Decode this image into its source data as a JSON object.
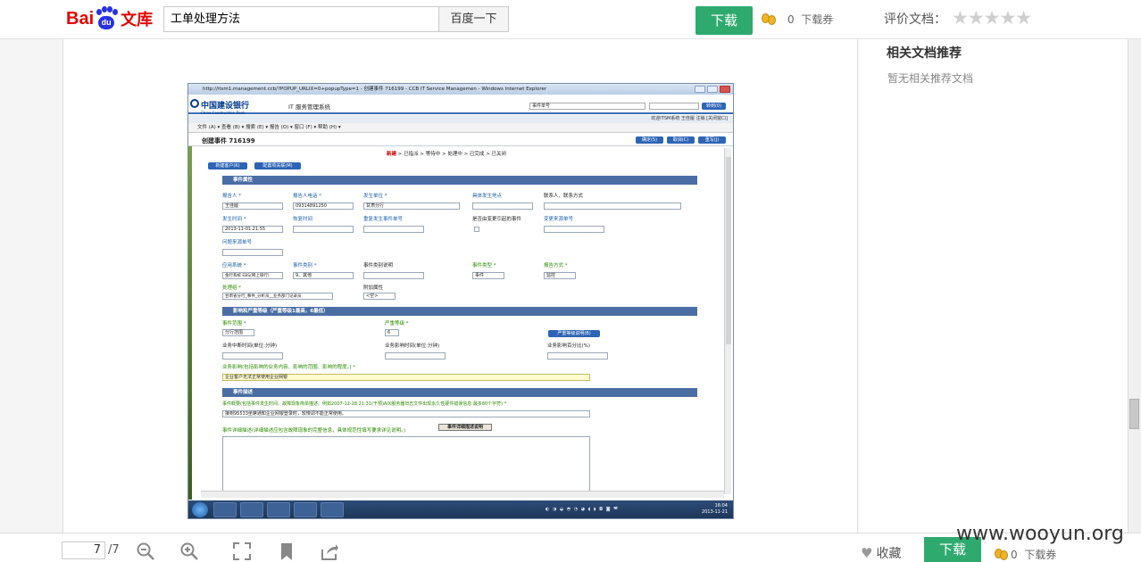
{
  "header": {
    "logo_text_1": "Bai",
    "logo_text_2": "du",
    "logo_text_3": "文库",
    "search_value": "工单处理方法",
    "search_button": "百度一下",
    "download_button": "下载",
    "voucher_count": "0",
    "voucher_label": "下载券",
    "rating_label": "评价文档：",
    "stars": "★★★★★"
  },
  "sidebar": {
    "title": "相关文档推荐",
    "empty_text": "暂无相关推荐文档"
  },
  "bottom": {
    "page_current": "7",
    "page_total": "/7",
    "favorite": "收藏",
    "download_button": "下载",
    "voucher_count": "0",
    "voucher_label": "下载券"
  },
  "watermark": "www.wooyun.org",
  "screenshot": {
    "ie_title": "http://itsm1.management.ccb/?POPUP_URLIX=0+popupType=1 - 创建事件 716199 - CCB IT Service Managemen - Windows Internet Explorer",
    "bank_name": "中国建设银行",
    "bank_name_en": "China Construction Bank",
    "system_name": "IT 服务管理系统",
    "search_select": "事件单号",
    "go_button": "转到(0)",
    "user_bar": "欢迎ITSM系统   王佳履  注销  [关闭窗口]",
    "menu": "文件 (A) ▾   查看 (B) ▾   搜索 (E) ▾   报告 (O) ▾   窗口 (F) ▾   帮助 (H) ▾",
    "event_title": "创建事件  716199",
    "ev_buttons": [
      "确定(S)",
      "取消(C)",
      "重写(J)"
    ],
    "steps_active": "新建",
    "steps_rest": " > 已指派 > 等待中 > 处理中 > 已完成 > 已关闭",
    "btn_new_customer": "新建客户(K)",
    "btn_config": "配置项关联(M)",
    "section_1": "事件属性",
    "reporter_label": "报告人 *",
    "reporter_value": "王佳履",
    "phone_label": "报告人电话 *",
    "phone_value": "09314891250",
    "unit_label": "发生单位 *",
    "unit_value": "甘肃分行",
    "location_label": "具体发生地点",
    "contact_label": "联系人、联系方式",
    "occur_label": "发生时间 *",
    "occur_value": "2013-11-01 21:55",
    "recover_label": "恢复时间",
    "repeat_label": "重复发生事件单号",
    "change_label": "是否由变更引起的事件",
    "change_no_label": "变更来源单号",
    "problem_label": "问题来源单号",
    "app_label": "应用系统 *",
    "app_value": "金行系统 EBS(网上银行)",
    "category_label": "事件类别 *",
    "category_value": "9、其他",
    "category_desc_label": "事件类别说明",
    "type_label": "事件类型 *",
    "type_value": "事件",
    "report_way_label": "报告方式 *",
    "report_way_value": "监控",
    "handler_label": "处理组 *",
    "handler_value": "甘肃省分行_事件_分析员__业务部门记录员",
    "extra_label": "附加属性",
    "extra_value": "<空>",
    "section_2": "影响和严重等级（严重等级1最高，6最低）",
    "scope_label": "事件范围 *",
    "scope_value": "分行范围",
    "severity_label": "严重等级 *",
    "severity_value": "6",
    "severity_btn": "严重等级说明(B)",
    "interrupt_label": "业务中断时间(单位:分钟)",
    "affect_time_label": "业务影响时间(单位:分钟)",
    "affect_pct_label": "业务影响百分比(%)",
    "impact_label": "业务影响(包括影响的业务内容、影响的范围、影响的程度。) *",
    "impact_value": "企业客户无法正常使用企业网银",
    "section_3": "事件描述",
    "summary_label": "事件概要(包括事件发生时间、故障现象简单描述。例如2007-12-28 21:31(干预)AIX服务器日志文件出现永久性硬件错误信息  最多80个字符) *",
    "summary_value": "接到95533坐席通知企业网银登录时，较慢调不能正常使用。",
    "detail_label": "事件详细描述(详细描述应包含故障现象的完整信息，具体规范性填写要求详见说明。)",
    "detail_btn": "事件详细描述说明",
    "clock_time": "16:04",
    "clock_date": "2013-11-21",
    "tray": "◐ ◑ ◒ ◓ ◔ ◕ ◖ ◗ ◘ ◙ ◚"
  }
}
